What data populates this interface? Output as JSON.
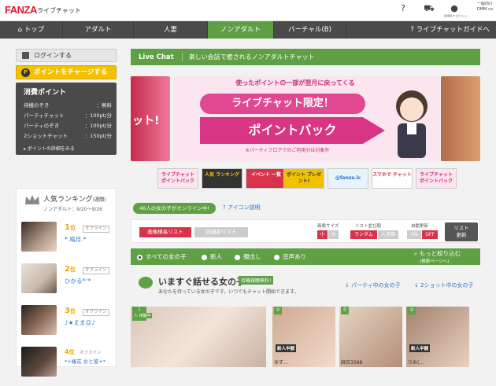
{
  "header": {
    "logo": "FANZA",
    "sub": "ライブチャット",
    "icons": [
      {
        "name": "help-icon",
        "glyph": "?"
      },
      {
        "name": "cart-icon",
        "glyph": "⛟"
      },
      {
        "name": "account-icon",
        "glyph": "●"
      }
    ],
    "account_label": "DMMアカウント",
    "account_lines": [
      "一般向け",
      "DMM.co"
    ]
  },
  "nav": {
    "items": [
      "トップ",
      "アダルト",
      "人妻",
      "ノンアダルト",
      "バーチャル(B)",
      "ライブチャットガイドへ"
    ],
    "active": 3,
    "home_glyph": "⌂",
    "guide_glyph": "?"
  },
  "sidebar": {
    "login_label": "ログインする",
    "charge_label": "ポイントをチャージする",
    "charge_glyph": "P",
    "points": {
      "title": "消費ポイント",
      "rows": [
        [
          "待機のぞき",
          "：無料"
        ],
        [
          "パーティチャット",
          "：100pt/分"
        ],
        [
          "パーティのぞき",
          "：100pt/分"
        ],
        [
          "2ショットチャット",
          "：150pt/分"
        ]
      ],
      "link": "ポイントの詳細をみる"
    }
  },
  "ranking": {
    "title": "人気ランキング",
    "title_suffix": "(週間)",
    "period": "ノンアダルト：9/20～9/26",
    "items": [
      {
        "rank": "1",
        "unit": "位",
        "status": "オフライン",
        "name": "*.鳩月.*"
      },
      {
        "rank": "2",
        "unit": "位",
        "status": "オフライン",
        "name": "ひかる*ᐟ*"
      },
      {
        "rank": "3",
        "unit": "位",
        "status": "オフライン",
        "name": "♪★えま☺♪"
      },
      {
        "rank": "4",
        "unit": "位",
        "status": "オフライン",
        "name": "*+椿花 おと彼+*"
      }
    ]
  },
  "main": {
    "livechat_label": "Live Chat",
    "livechat_desc": "楽しい会話で癒されるノンアダルトチャット",
    "banner": {
      "head": "使ったポイントの一部が翌月に戻ってくる",
      "limited": "ライブチャット限定！",
      "pointback": "ポイントバック",
      "note": "※パーティフロアでのご利用分は対象外",
      "left_text": "ット!"
    },
    "sub_banners": [
      "ライブチャット ポイントバック",
      "人気 ランキング",
      "イベント 一覧",
      "ポイント プレゼント!",
      "@fanza.lc",
      "スマホで チャット",
      "ライブチャット ポイントバック"
    ],
    "online": "46人の女の子がオンライン中!",
    "icon_explain": "アイコン説明",
    "controls": {
      "tab_photo": "画像横長リスト",
      "tab_detail": "詳細系リスト",
      "size_label": "画像サイズ",
      "size_opts": [
        "小",
        "大"
      ],
      "order_label": "リスト並び順",
      "order_opts": [
        "ランダム",
        "入室順"
      ],
      "auto_label": "自動更新",
      "auto_opts": [
        "ON",
        "OFF"
      ],
      "refresh": [
        "リスト",
        "更新"
      ]
    },
    "filters": [
      "すべての女の子",
      "新人",
      "親出し",
      "音声あり"
    ],
    "narrow": "もっと絞り込む",
    "narrow_sub": "(検索ページへ)",
    "talk": {
      "title": "いますぐ話せる女の子",
      "badge": "待機視聴無料!",
      "sub": "あなたを待っている女の子です。いつでもチャット開始できます。",
      "link_party": "パーティ中の女の子",
      "link_two": "2ショット中の女の子"
    },
    "cards": [
      {
        "badge": "1",
        "tag": "人 視聴中",
        "name": ""
      },
      {
        "badge": "0",
        "tag": "新人半額",
        "name": "ゆず…"
      },
      {
        "badge": "0",
        "tag": "",
        "name": "麻衣3588"
      },
      {
        "badge": "0",
        "tag": "新人半額",
        "name": "りお(…"
      }
    ]
  }
}
